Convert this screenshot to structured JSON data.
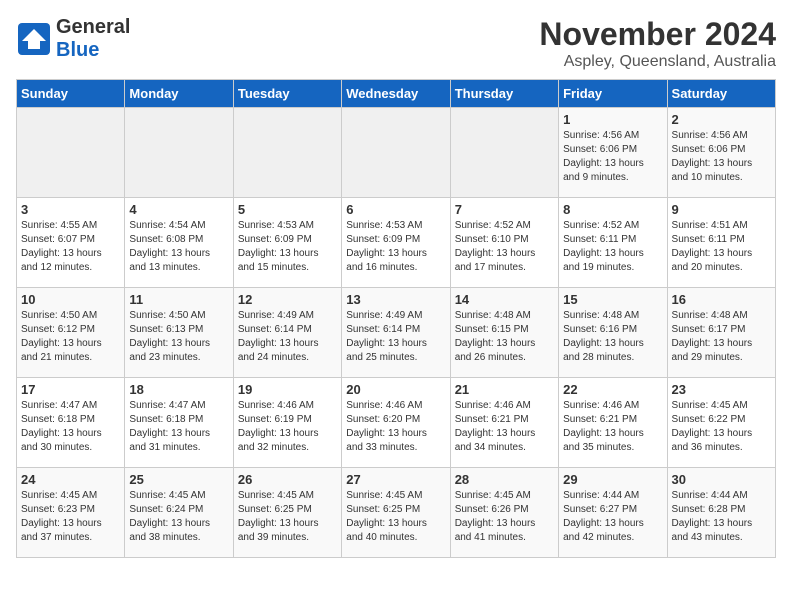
{
  "header": {
    "logo_general": "General",
    "logo_blue": "Blue",
    "month": "November 2024",
    "location": "Aspley, Queensland, Australia"
  },
  "days_of_week": [
    "Sunday",
    "Monday",
    "Tuesday",
    "Wednesday",
    "Thursday",
    "Friday",
    "Saturday"
  ],
  "weeks": [
    [
      {
        "day": "",
        "info": ""
      },
      {
        "day": "",
        "info": ""
      },
      {
        "day": "",
        "info": ""
      },
      {
        "day": "",
        "info": ""
      },
      {
        "day": "",
        "info": ""
      },
      {
        "day": "1",
        "info": "Sunrise: 4:56 AM\nSunset: 6:06 PM\nDaylight: 13 hours\nand 9 minutes."
      },
      {
        "day": "2",
        "info": "Sunrise: 4:56 AM\nSunset: 6:06 PM\nDaylight: 13 hours\nand 10 minutes."
      }
    ],
    [
      {
        "day": "3",
        "info": "Sunrise: 4:55 AM\nSunset: 6:07 PM\nDaylight: 13 hours\nand 12 minutes."
      },
      {
        "day": "4",
        "info": "Sunrise: 4:54 AM\nSunset: 6:08 PM\nDaylight: 13 hours\nand 13 minutes."
      },
      {
        "day": "5",
        "info": "Sunrise: 4:53 AM\nSunset: 6:09 PM\nDaylight: 13 hours\nand 15 minutes."
      },
      {
        "day": "6",
        "info": "Sunrise: 4:53 AM\nSunset: 6:09 PM\nDaylight: 13 hours\nand 16 minutes."
      },
      {
        "day": "7",
        "info": "Sunrise: 4:52 AM\nSunset: 6:10 PM\nDaylight: 13 hours\nand 17 minutes."
      },
      {
        "day": "8",
        "info": "Sunrise: 4:52 AM\nSunset: 6:11 PM\nDaylight: 13 hours\nand 19 minutes."
      },
      {
        "day": "9",
        "info": "Sunrise: 4:51 AM\nSunset: 6:11 PM\nDaylight: 13 hours\nand 20 minutes."
      }
    ],
    [
      {
        "day": "10",
        "info": "Sunrise: 4:50 AM\nSunset: 6:12 PM\nDaylight: 13 hours\nand 21 minutes."
      },
      {
        "day": "11",
        "info": "Sunrise: 4:50 AM\nSunset: 6:13 PM\nDaylight: 13 hours\nand 23 minutes."
      },
      {
        "day": "12",
        "info": "Sunrise: 4:49 AM\nSunset: 6:14 PM\nDaylight: 13 hours\nand 24 minutes."
      },
      {
        "day": "13",
        "info": "Sunrise: 4:49 AM\nSunset: 6:14 PM\nDaylight: 13 hours\nand 25 minutes."
      },
      {
        "day": "14",
        "info": "Sunrise: 4:48 AM\nSunset: 6:15 PM\nDaylight: 13 hours\nand 26 minutes."
      },
      {
        "day": "15",
        "info": "Sunrise: 4:48 AM\nSunset: 6:16 PM\nDaylight: 13 hours\nand 28 minutes."
      },
      {
        "day": "16",
        "info": "Sunrise: 4:48 AM\nSunset: 6:17 PM\nDaylight: 13 hours\nand 29 minutes."
      }
    ],
    [
      {
        "day": "17",
        "info": "Sunrise: 4:47 AM\nSunset: 6:18 PM\nDaylight: 13 hours\nand 30 minutes."
      },
      {
        "day": "18",
        "info": "Sunrise: 4:47 AM\nSunset: 6:18 PM\nDaylight: 13 hours\nand 31 minutes."
      },
      {
        "day": "19",
        "info": "Sunrise: 4:46 AM\nSunset: 6:19 PM\nDaylight: 13 hours\nand 32 minutes."
      },
      {
        "day": "20",
        "info": "Sunrise: 4:46 AM\nSunset: 6:20 PM\nDaylight: 13 hours\nand 33 minutes."
      },
      {
        "day": "21",
        "info": "Sunrise: 4:46 AM\nSunset: 6:21 PM\nDaylight: 13 hours\nand 34 minutes."
      },
      {
        "day": "22",
        "info": "Sunrise: 4:46 AM\nSunset: 6:21 PM\nDaylight: 13 hours\nand 35 minutes."
      },
      {
        "day": "23",
        "info": "Sunrise: 4:45 AM\nSunset: 6:22 PM\nDaylight: 13 hours\nand 36 minutes."
      }
    ],
    [
      {
        "day": "24",
        "info": "Sunrise: 4:45 AM\nSunset: 6:23 PM\nDaylight: 13 hours\nand 37 minutes."
      },
      {
        "day": "25",
        "info": "Sunrise: 4:45 AM\nSunset: 6:24 PM\nDaylight: 13 hours\nand 38 minutes."
      },
      {
        "day": "26",
        "info": "Sunrise: 4:45 AM\nSunset: 6:25 PM\nDaylight: 13 hours\nand 39 minutes."
      },
      {
        "day": "27",
        "info": "Sunrise: 4:45 AM\nSunset: 6:25 PM\nDaylight: 13 hours\nand 40 minutes."
      },
      {
        "day": "28",
        "info": "Sunrise: 4:45 AM\nSunset: 6:26 PM\nDaylight: 13 hours\nand 41 minutes."
      },
      {
        "day": "29",
        "info": "Sunrise: 4:44 AM\nSunset: 6:27 PM\nDaylight: 13 hours\nand 42 minutes."
      },
      {
        "day": "30",
        "info": "Sunrise: 4:44 AM\nSunset: 6:28 PM\nDaylight: 13 hours\nand 43 minutes."
      }
    ]
  ]
}
